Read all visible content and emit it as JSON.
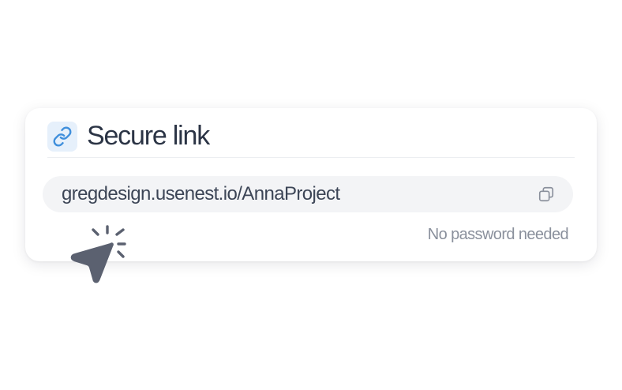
{
  "card": {
    "title": "Secure link",
    "icon": "link-icon",
    "url": "gregdesign.usenest.io/AnnaProject",
    "copy_icon": "copy-icon",
    "note": "No password needed"
  },
  "cursor": {
    "icon": "cursor-click-icon"
  },
  "colors": {
    "title": "#2b3445",
    "accent": "#3f8fdc",
    "icon_bg": "#e6f0fb",
    "field_bg": "#f3f4f6",
    "muted": "#8a909c",
    "cursor": "#5b6170"
  }
}
